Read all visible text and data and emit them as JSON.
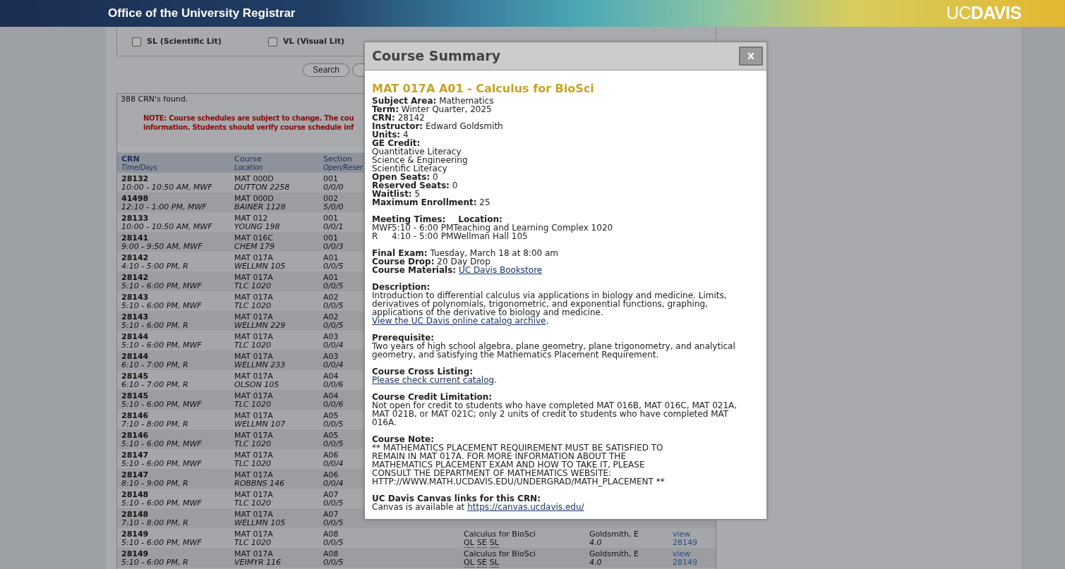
{
  "header": {
    "title": "Office of the University Registrar",
    "logo_left": "UC",
    "logo_right": "DAVIS"
  },
  "filters": [
    {
      "label": "SL (Scientific Lit)",
      "checked": false
    },
    {
      "label": "VL (Visual Lit)",
      "checked": false
    }
  ],
  "search_button": "Search",
  "results": {
    "count": "388 CRN's found.",
    "note_lines": [
      "NOTE: Course schedules are subject to change. The cou",
      "information. Students should verify course schedule inf"
    ],
    "columns": [
      [
        "CRN",
        "Time/Days"
      ],
      [
        "Course",
        "Location"
      ],
      [
        "Section",
        "Open/Reser"
      ]
    ],
    "rows": [
      {
        "crn": "28132",
        "time": "10:00 - 10:50 AM, MWF",
        "course": "MAT 000D",
        "location": "DUTTON 2258",
        "section": "001",
        "seats": "0/0/0"
      },
      {
        "crn": "41498",
        "time": "12:10 - 1:00 PM, MWF",
        "course": "MAT 000D",
        "location": "BAINER 1128",
        "section": "002",
        "seats": "5/0/0"
      },
      {
        "crn": "28133",
        "time": "10:00 - 10:50 AM, MWF",
        "course": "MAT 012",
        "location": "YOUNG 198",
        "section": "001",
        "seats": "0/0/1"
      },
      {
        "crn": "28141",
        "time": "9:00 - 9:50 AM, MWF",
        "course": "MAT 016C",
        "location": "CHEM 179",
        "section": "001",
        "seats": "0/0/3"
      },
      {
        "crn": "28142",
        "time": "4:10 - 5:00 PM, R",
        "course": "MAT 017A",
        "location": "WELLMN 105",
        "section": "A01",
        "seats": "0/0/5"
      },
      {
        "crn": "28142",
        "time": "5:10 - 6:00 PM, MWF",
        "course": "MAT 017A",
        "location": "TLC 1020",
        "section": "A01",
        "seats": "0/0/5"
      },
      {
        "crn": "28143",
        "time": "5:10 - 6:00 PM, MWF",
        "course": "MAT 017A",
        "location": "TLC 1020",
        "section": "A02",
        "seats": "0/0/5"
      },
      {
        "crn": "28143",
        "time": "5:10 - 6:00 PM, R",
        "course": "MAT 017A",
        "location": "WELLMN 229",
        "section": "A02",
        "seats": "0/0/5"
      },
      {
        "crn": "28144",
        "time": "5:10 - 6:00 PM, MWF",
        "course": "MAT 017A",
        "location": "TLC 1020",
        "section": "A03",
        "seats": "0/0/4"
      },
      {
        "crn": "28144",
        "time": "6:10 - 7:00 PM, R",
        "course": "MAT 017A",
        "location": "WELLMN 233",
        "section": "A03",
        "seats": "0/0/4"
      },
      {
        "crn": "28145",
        "time": "6:10 - 7:00 PM, R",
        "course": "MAT 017A",
        "location": "OLSON 105",
        "section": "A04",
        "seats": "0/0/6"
      },
      {
        "crn": "28145",
        "time": "5:10 - 6:00 PM, MWF",
        "course": "MAT 017A",
        "location": "TLC 1020",
        "section": "A04",
        "seats": "0/0/6"
      },
      {
        "crn": "28146",
        "time": "7:10 - 8:00 PM, R",
        "course": "MAT 017A",
        "location": "WELLMN 107",
        "section": "A05",
        "seats": "0/0/5"
      },
      {
        "crn": "28146",
        "time": "5:10 - 6:00 PM, MWF",
        "course": "MAT 017A",
        "location": "TLC 1020",
        "section": "A05",
        "seats": "0/0/5"
      },
      {
        "crn": "28147",
        "time": "5:10 - 6:00 PM, MWF",
        "course": "MAT 017A",
        "location": "TLC 1020",
        "section": "A06",
        "seats": "0/0/4"
      },
      {
        "crn": "28147",
        "time": "8:10 - 9:00 PM, R",
        "course": "MAT 017A",
        "location": "ROBBNS 146",
        "section": "A06",
        "seats": "0/0/4"
      },
      {
        "crn": "28148",
        "time": "5:10 - 6:00 PM, MWF",
        "course": "MAT 017A",
        "location": "TLC 1020",
        "section": "A07",
        "seats": "0/0/5"
      },
      {
        "crn": "28148",
        "time": "7:10 - 8:00 PM, R",
        "course": "MAT 017A",
        "location": "WELLMN 105",
        "section": "A07",
        "seats": "0/0/5"
      },
      {
        "crn": "28149",
        "time": "5:10 - 6:00 PM, MWF",
        "course": "MAT 017A",
        "location": "TLC 1020",
        "section": "A08",
        "seats": "0/0/5",
        "title": "Calculus for BioSci",
        "ge": [
          "QL",
          "SE",
          "SL"
        ],
        "instructor": "Goldsmith, E",
        "units": "4.0",
        "view": "view",
        "crn_link": "28149"
      },
      {
        "crn": "28149",
        "time": "5:10 - 6:00 PM, R",
        "course": "MAT 017A",
        "location": "VEIMYR 116",
        "section": "A08",
        "seats": "0/0/5",
        "title": "Calculus for BioSci",
        "ge": [
          "QL",
          "SE",
          "SL"
        ],
        "instructor": "Goldsmith, E",
        "units": "4.0",
        "view": "view",
        "crn_link": "28149"
      }
    ]
  },
  "modal": {
    "title": "Course Summary",
    "close": "X",
    "heading": "MAT 017A A01 - Calculus for BioSci",
    "blocks": [
      [
        {
          "kind": "field",
          "label": "Subject Area:",
          "value": "Mathematics"
        },
        {
          "kind": "field",
          "label": "Term:",
          "value": "Winter Quarter, 2025"
        },
        {
          "kind": "field",
          "label": "CRN:",
          "value": "28142"
        },
        {
          "kind": "field",
          "label": "Instructor:",
          "value": "Edward Goldsmith"
        },
        {
          "kind": "field",
          "label": "Units:",
          "value": "4"
        },
        {
          "kind": "heading",
          "label": "GE Credit:"
        },
        {
          "kind": "text",
          "text": "Quantitative Literacy"
        },
        {
          "kind": "text",
          "text": "Science & Engineering"
        },
        {
          "kind": "text",
          "text": "Scientific Literacy"
        },
        {
          "kind": "field",
          "label": "Open Seats:",
          "value": "0"
        },
        {
          "kind": "field",
          "label": "Reserved Seats:",
          "value": "0"
        },
        {
          "kind": "field",
          "label": "Waitlist:",
          "value": "5"
        },
        {
          "kind": "field",
          "label": "Maximum Enrollment:",
          "value": "25"
        }
      ],
      [
        {
          "kind": "meeting_head",
          "label": "Meeting Times:",
          "label2": "Location:"
        },
        {
          "kind": "meeting_row",
          "days": "MWF",
          "time": "5:10 - 6:00 PM",
          "location": "Teaching and Learning Complex 1020"
        },
        {
          "kind": "meeting_row",
          "days": "R",
          "time": "4:10 - 5:00 PM",
          "location": "Wellman Hall 105"
        }
      ],
      [
        {
          "kind": "field",
          "label": "Final Exam:",
          "value": "Tuesday, March 18 at 8:00 am"
        },
        {
          "kind": "field",
          "label": "Course Drop:",
          "value": "20 Day Drop"
        },
        {
          "kind": "link_field",
          "label": "Course Materials:",
          "link": "UC Davis Bookstore"
        }
      ],
      [
        {
          "kind": "heading",
          "label": "Description:"
        },
        {
          "kind": "text",
          "text": "Introduction to differential calculus via applications in biology and medicine. Limits, derivatives of polynomials, trigonometric, and exponential functions, graphing, applications of the derivative to biology and medicine."
        },
        {
          "kind": "link",
          "link": "View the UC Davis online catalog archive",
          "suffix": "."
        }
      ],
      [
        {
          "kind": "heading",
          "label": "Prerequisite:"
        },
        {
          "kind": "text",
          "text": "Two years of high school algebra, plane geometry, plane trigonometry, and analytical geometry, and satisfying the Mathematics Placement Requirement."
        }
      ],
      [
        {
          "kind": "heading",
          "label": "Course Cross Listing:"
        },
        {
          "kind": "link",
          "link": "Please check current catalog",
          "suffix": "."
        }
      ],
      [
        {
          "kind": "heading",
          "label": "Course Credit Limitation:"
        },
        {
          "kind": "text",
          "text": "Not open for credit to students who have completed MAT 016B, MAT 016C, MAT 021A, MAT 021B, or MAT 021C; only 2 units of credit to students who have completed MAT 016A."
        }
      ],
      [
        {
          "kind": "heading",
          "label": "Course Note:"
        },
        {
          "kind": "note",
          "text": "** MATHEMATICS PLACEMENT REQUIREMENT MUST BE SATISFIED TO\nREMAIN IN MAT 017A. FOR MORE INFORMATION ABOUT THE\nMATHEMATICS PLACEMENT EXAM AND HOW TO TAKE IT, PLEASE\nCONSULT THE DEPARTMENT OF MATHEMATICS WEBSITE:\nHTTP://WWW.MATH.UCDAVIS.EDU/UNDERGRAD/MATH_PLACEMENT **"
        }
      ],
      [
        {
          "kind": "heading",
          "label": "UC Davis Canvas links for this CRN:"
        },
        {
          "kind": "prefixed_link",
          "prefix": "Canvas is available at ",
          "link": "https://canvas.ucdavis.edu/"
        }
      ]
    ]
  }
}
